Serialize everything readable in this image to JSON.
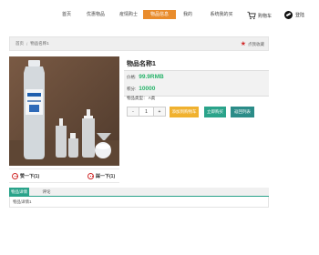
{
  "nav": {
    "items": [
      {
        "label": "首页",
        "active": false
      },
      {
        "label": "优惠物品",
        "active": false
      },
      {
        "label": "疫情购士",
        "active": false
      },
      {
        "label": "物品信息",
        "active": true
      },
      {
        "label": "我的",
        "active": false
      },
      {
        "label": "系统我的买",
        "active": false
      }
    ],
    "cart_label": "购物车",
    "login_label": "登陆"
  },
  "breadcrumb": {
    "home": "首页",
    "separator": "/",
    "current": "物品名称1",
    "favorite_label": "点我收藏"
  },
  "product": {
    "name": "物品名称1",
    "price_label": "价格:",
    "price": "99.9RMB",
    "points_label": "积分:",
    "points": "10000",
    "type_label": "物品类型：",
    "type_value": "A类",
    "quantity": "1",
    "minus": "-",
    "plus": "+"
  },
  "actions": {
    "add_cart": "添加到购物车",
    "buy_now": "立即购买",
    "back": "返回列表"
  },
  "votes": {
    "up": "赞一下(1)",
    "down": "踩一下(1)"
  },
  "tabs": [
    {
      "label": "物品详情",
      "active": true
    },
    {
      "label": "评论",
      "active": false
    }
  ],
  "detail_text": "物品详情1"
}
